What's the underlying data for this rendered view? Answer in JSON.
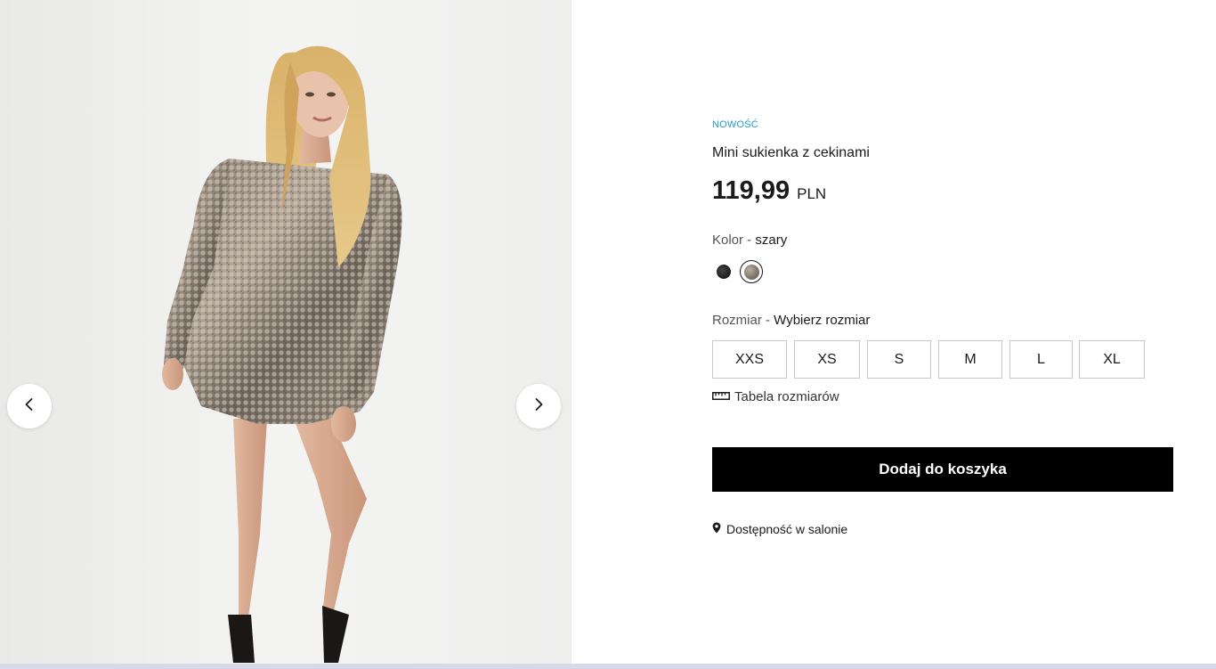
{
  "gallery": {
    "image_alt": "Model in sequin mini dress",
    "prev_icon": "chevron-left-icon",
    "next_icon": "chevron-right-icon"
  },
  "product": {
    "badge": "NOWOŚĆ",
    "name": "Mini sukienka z cekinami",
    "price": "119,99",
    "currency": "PLN",
    "color_label": "Kolor - ",
    "color_value": "szary",
    "colors": [
      {
        "name": "czarny",
        "hex": "#1a1a1a",
        "selected": false
      },
      {
        "name": "szary",
        "hex": "#7d7366",
        "selected": true
      }
    ],
    "size_label": "Rozmiar - ",
    "size_value": "Wybierz rozmiar",
    "sizes": [
      "XXS",
      "XS",
      "S",
      "M",
      "L",
      "XL"
    ],
    "size_table": "Tabela rozmiarów",
    "size_table_icon": "ruler-icon",
    "add_to_cart": "Dodaj do koszyka",
    "availability": "Dostępność w salonie",
    "availability_icon": "location-pin-icon"
  },
  "colors": {
    "badge": "#1e9bd7",
    "button_bg": "#000000",
    "button_text": "#ffffff",
    "border": "#c8c8c8"
  }
}
